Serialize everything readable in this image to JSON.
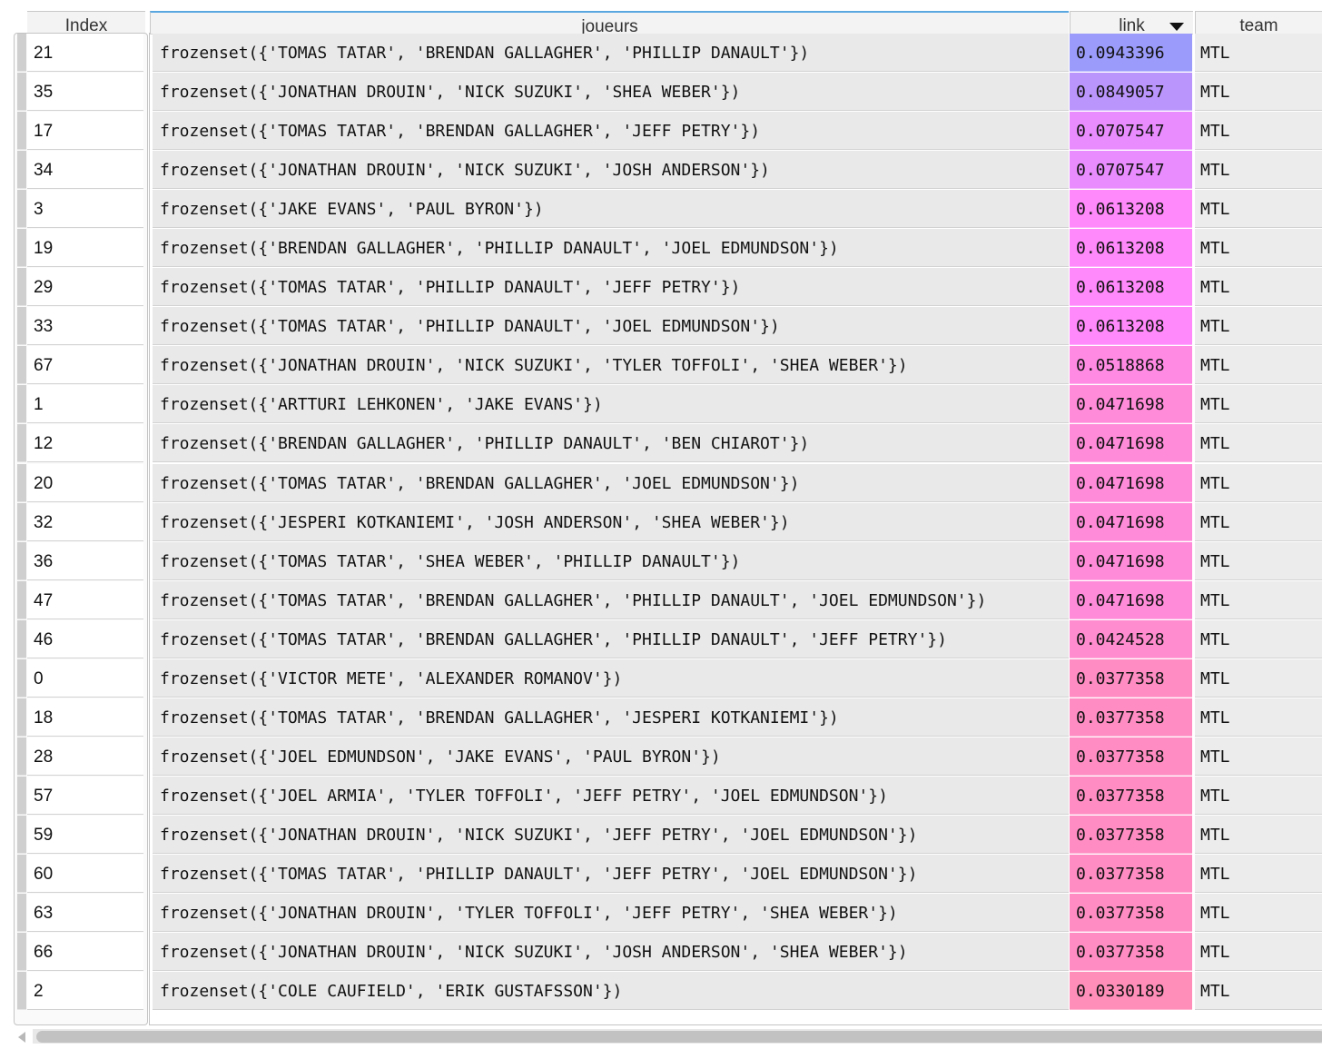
{
  "columns": {
    "index": "Index",
    "joueurs": "joueurs",
    "link": "link",
    "team": "team"
  },
  "colors": {
    "link_high": "#9b9bfb",
    "link_mid": "#ff87ff",
    "link_low": "#ff8eb8"
  },
  "rows": [
    {
      "index": "21",
      "joueurs": "frozenset({'TOMAS TATAR', 'BRENDAN GALLAGHER', 'PHILLIP DANAULT'})",
      "link": "0.0943396",
      "team": "MTL"
    },
    {
      "index": "35",
      "joueurs": "frozenset({'JONATHAN DROUIN', 'NICK SUZUKI', 'SHEA WEBER'})",
      "link": "0.0849057",
      "team": "MTL"
    },
    {
      "index": "17",
      "joueurs": "frozenset({'TOMAS TATAR', 'BRENDAN GALLAGHER', 'JEFF PETRY'})",
      "link": "0.0707547",
      "team": "MTL"
    },
    {
      "index": "34",
      "joueurs": "frozenset({'JONATHAN DROUIN', 'NICK SUZUKI', 'JOSH ANDERSON'})",
      "link": "0.0707547",
      "team": "MTL"
    },
    {
      "index": "3",
      "joueurs": "frozenset({'JAKE EVANS', 'PAUL BYRON'})",
      "link": "0.0613208",
      "team": "MTL"
    },
    {
      "index": "19",
      "joueurs": "frozenset({'BRENDAN GALLAGHER', 'PHILLIP DANAULT', 'JOEL EDMUNDSON'})",
      "link": "0.0613208",
      "team": "MTL"
    },
    {
      "index": "29",
      "joueurs": "frozenset({'TOMAS TATAR', 'PHILLIP DANAULT', 'JEFF PETRY'})",
      "link": "0.0613208",
      "team": "MTL"
    },
    {
      "index": "33",
      "joueurs": "frozenset({'TOMAS TATAR', 'PHILLIP DANAULT', 'JOEL EDMUNDSON'})",
      "link": "0.0613208",
      "team": "MTL"
    },
    {
      "index": "67",
      "joueurs": "frozenset({'JONATHAN DROUIN', 'NICK SUZUKI', 'TYLER TOFFOLI', 'SHEA WEBER'})",
      "link": "0.0518868",
      "team": "MTL"
    },
    {
      "index": "1",
      "joueurs": "frozenset({'ARTTURI LEHKONEN', 'JAKE EVANS'})",
      "link": "0.0471698",
      "team": "MTL"
    },
    {
      "index": "12",
      "joueurs": "frozenset({'BRENDAN GALLAGHER', 'PHILLIP DANAULT', 'BEN CHIAROT'})",
      "link": "0.0471698",
      "team": "MTL"
    },
    {
      "index": "20",
      "joueurs": "frozenset({'TOMAS TATAR', 'BRENDAN GALLAGHER', 'JOEL EDMUNDSON'})",
      "link": "0.0471698",
      "team": "MTL"
    },
    {
      "index": "32",
      "joueurs": "frozenset({'JESPERI KOTKANIEMI', 'JOSH ANDERSON', 'SHEA WEBER'})",
      "link": "0.0471698",
      "team": "MTL"
    },
    {
      "index": "36",
      "joueurs": "frozenset({'TOMAS TATAR', 'SHEA WEBER', 'PHILLIP DANAULT'})",
      "link": "0.0471698",
      "team": "MTL"
    },
    {
      "index": "47",
      "joueurs": "frozenset({'TOMAS TATAR', 'BRENDAN GALLAGHER', 'PHILLIP DANAULT', 'JOEL EDMUNDSON'})",
      "link": "0.0471698",
      "team": "MTL"
    },
    {
      "index": "46",
      "joueurs": "frozenset({'TOMAS TATAR', 'BRENDAN GALLAGHER', 'PHILLIP DANAULT', 'JEFF PETRY'})",
      "link": "0.0424528",
      "team": "MTL"
    },
    {
      "index": "0",
      "joueurs": "frozenset({'VICTOR METE', 'ALEXANDER ROMANOV'})",
      "link": "0.0377358",
      "team": "MTL"
    },
    {
      "index": "18",
      "joueurs": "frozenset({'TOMAS TATAR', 'BRENDAN GALLAGHER', 'JESPERI KOTKANIEMI'})",
      "link": "0.0377358",
      "team": "MTL"
    },
    {
      "index": "28",
      "joueurs": "frozenset({'JOEL EDMUNDSON', 'JAKE EVANS', 'PAUL BYRON'})",
      "link": "0.0377358",
      "team": "MTL"
    },
    {
      "index": "57",
      "joueurs": "frozenset({'JOEL ARMIA', 'TYLER TOFFOLI', 'JEFF PETRY', 'JOEL EDMUNDSON'})",
      "link": "0.0377358",
      "team": "MTL"
    },
    {
      "index": "59",
      "joueurs": "frozenset({'JONATHAN DROUIN', 'NICK SUZUKI', 'JEFF PETRY', 'JOEL EDMUNDSON'})",
      "link": "0.0377358",
      "team": "MTL"
    },
    {
      "index": "60",
      "joueurs": "frozenset({'TOMAS TATAR', 'PHILLIP DANAULT', 'JEFF PETRY', 'JOEL EDMUNDSON'})",
      "link": "0.0377358",
      "team": "MTL"
    },
    {
      "index": "63",
      "joueurs": "frozenset({'JONATHAN DROUIN', 'TYLER TOFFOLI', 'JEFF PETRY', 'SHEA WEBER'})",
      "link": "0.0377358",
      "team": "MTL"
    },
    {
      "index": "66",
      "joueurs": "frozenset({'JONATHAN DROUIN', 'NICK SUZUKI', 'JOSH ANDERSON', 'SHEA WEBER'})",
      "link": "0.0377358",
      "team": "MTL"
    },
    {
      "index": "2",
      "joueurs": "frozenset({'COLE CAUFIELD', 'ERIK GUSTAFSSON'})",
      "link": "0.0330189",
      "team": "MTL"
    }
  ],
  "icons": {
    "sort": "sort-descending-icon",
    "scroll_left": "scroll-left-arrow-icon"
  }
}
